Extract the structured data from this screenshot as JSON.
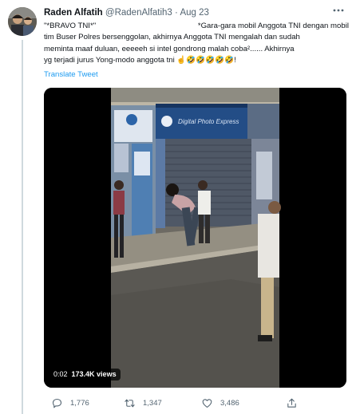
{
  "tweet": {
    "author_name": "Raden Alfatih",
    "author_handle": "@RadenAlfatih3",
    "separator": "·",
    "date": "Aug 23",
    "text_lines": [
      "\"*BRAVO TNI*\"",
      "*Gara-gara mobil Anggota TNI dengan mobil",
      "tim Buser Polres bersenggolan, akhirnya Anggota TNI mengalah dan sudah",
      "meminta maaf duluan, eeeeeh si intel gondrong malah coba²...... Akhirnya",
      "yg terjadi jurus Yong-modo anggota tni ☝🤣🤣🤣🤣🤣!"
    ],
    "translate_label": "Translate Tweet"
  },
  "media": {
    "type": "video",
    "timecode": "0:02",
    "views": "173.4K views",
    "sign_text": "Digital Photo Express"
  },
  "actions": {
    "replies": "1,776",
    "retweets": "1,347",
    "likes": "3,486"
  },
  "colors": {
    "accent": "#1d9bf0",
    "secondary_text": "#536471"
  }
}
